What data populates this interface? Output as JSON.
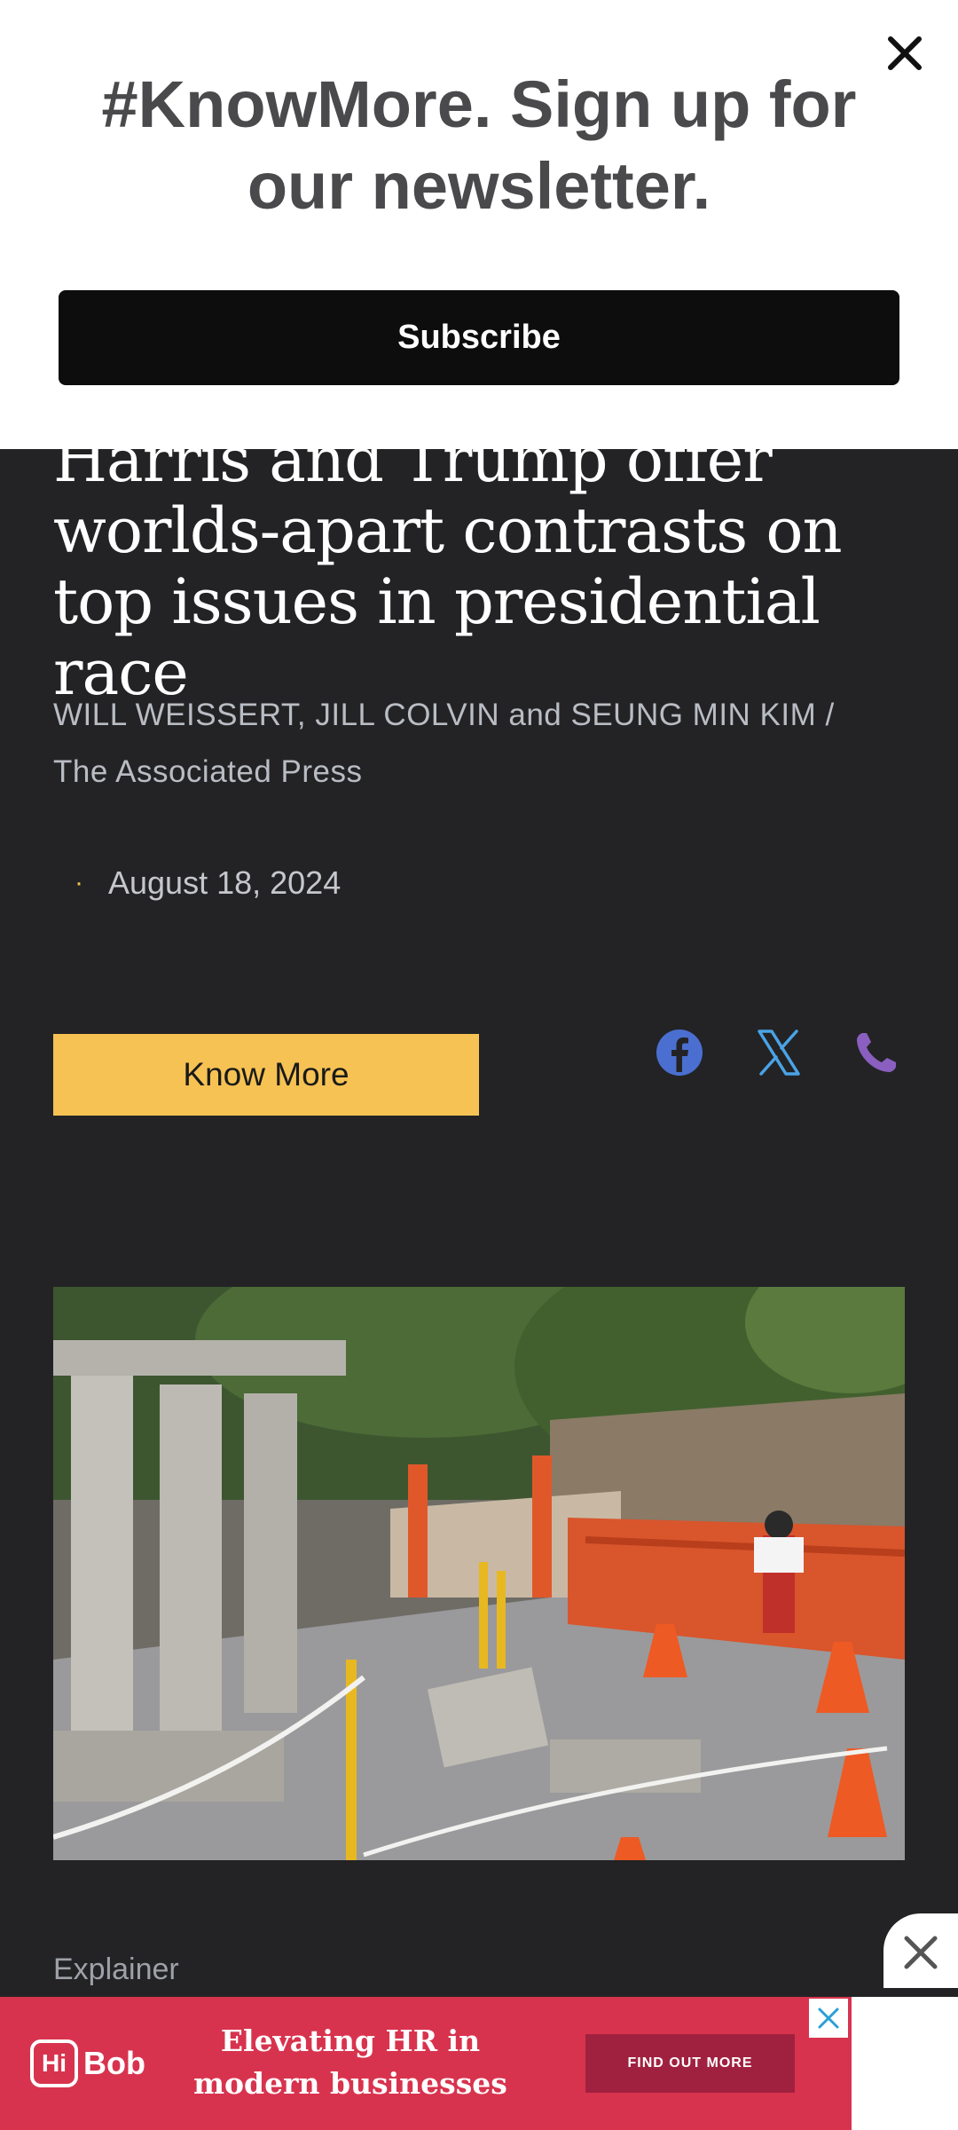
{
  "newsletter": {
    "title": "#KnowMore. Sign up for our newsletter.",
    "subscribe_label": "Subscribe",
    "close_icon": "close-icon"
  },
  "article": {
    "headline": "Harris and Trump offer worlds-apart contrasts on top issues in presidential race",
    "byline": "WILL WEISSERT, JILL COLVIN and SEUNG MIN KIM / The Associated Press",
    "date_separator": "·",
    "date": "August 18, 2024",
    "know_more_label": "Know More",
    "share_icons": [
      "facebook-icon",
      "x-icon",
      "phone-icon"
    ],
    "section_label": "Explainer"
  },
  "ad": {
    "brand": "Bob",
    "brand_mark": "Hi",
    "headline": "Elevating HR in modern businesses",
    "cta": "FIND OUT MORE"
  },
  "colors": {
    "page_bg": "#232325",
    "accent_yellow": "#f6c253",
    "facebook_blue": "#4a6fd0",
    "x_blue": "#4aa3e6",
    "phone_purple": "#8a5fc0",
    "ad_red": "#d8334e"
  }
}
